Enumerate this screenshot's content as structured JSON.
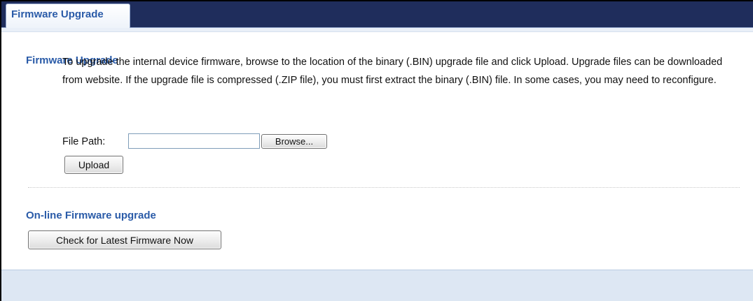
{
  "tab": {
    "label": "Firmware Upgrade"
  },
  "firmware_section": {
    "title": "Firmware Upgrade",
    "description": "To upgrade the internal device firmware, browse to the location of the binary (.BIN) upgrade file and click Upload. Upgrade files can be downloaded from website. If the upgrade file is compressed (.ZIP file), you must first extract the binary (.BIN) file. In some cases, you may need to reconfigure.",
    "file_path_label": "File Path:",
    "file_path_value": "",
    "browse_label": "Browse...",
    "upload_label": "Upload"
  },
  "online_section": {
    "title": "On-line Firmware upgrade",
    "check_label": "Check for Latest Firmware Now"
  },
  "colors": {
    "tabbar": "#1f2d5c",
    "accent_text": "#2a5ba8",
    "footer_band": "#dde7f3"
  }
}
